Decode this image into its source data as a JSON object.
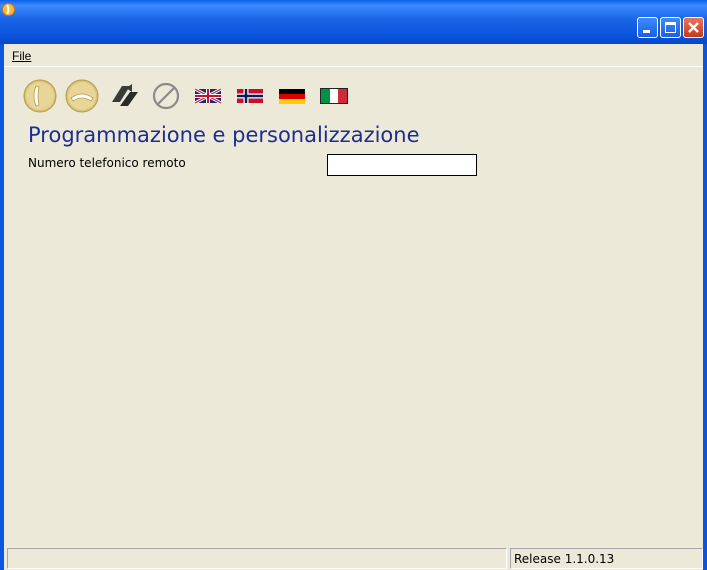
{
  "titlebar": {
    "title": "",
    "buttons": [
      "minimize",
      "maximize",
      "close"
    ]
  },
  "menubar": {
    "items": [
      {
        "label": "File",
        "mnemonic": "F"
      }
    ]
  },
  "toolbar": {
    "tools": [
      {
        "name": "dial-icon"
      },
      {
        "name": "hangup-icon"
      },
      {
        "name": "transfer-icon"
      },
      {
        "name": "no-entry-icon"
      },
      {
        "name": "flag-uk-icon"
      },
      {
        "name": "flag-norway-icon"
      },
      {
        "name": "flag-germany-icon"
      },
      {
        "name": "flag-italy-icon"
      }
    ]
  },
  "main": {
    "title": "Programmazione e personalizzazione",
    "remote_number_label": "Numero telefonico remoto",
    "remote_number_value": ""
  },
  "statusbar": {
    "left": "",
    "release": "Release 1.1.0.13"
  },
  "colors": {
    "titlebar": "#0a56e0",
    "page_title": "#1d2e8f",
    "client_bg": "#ece9d8"
  }
}
